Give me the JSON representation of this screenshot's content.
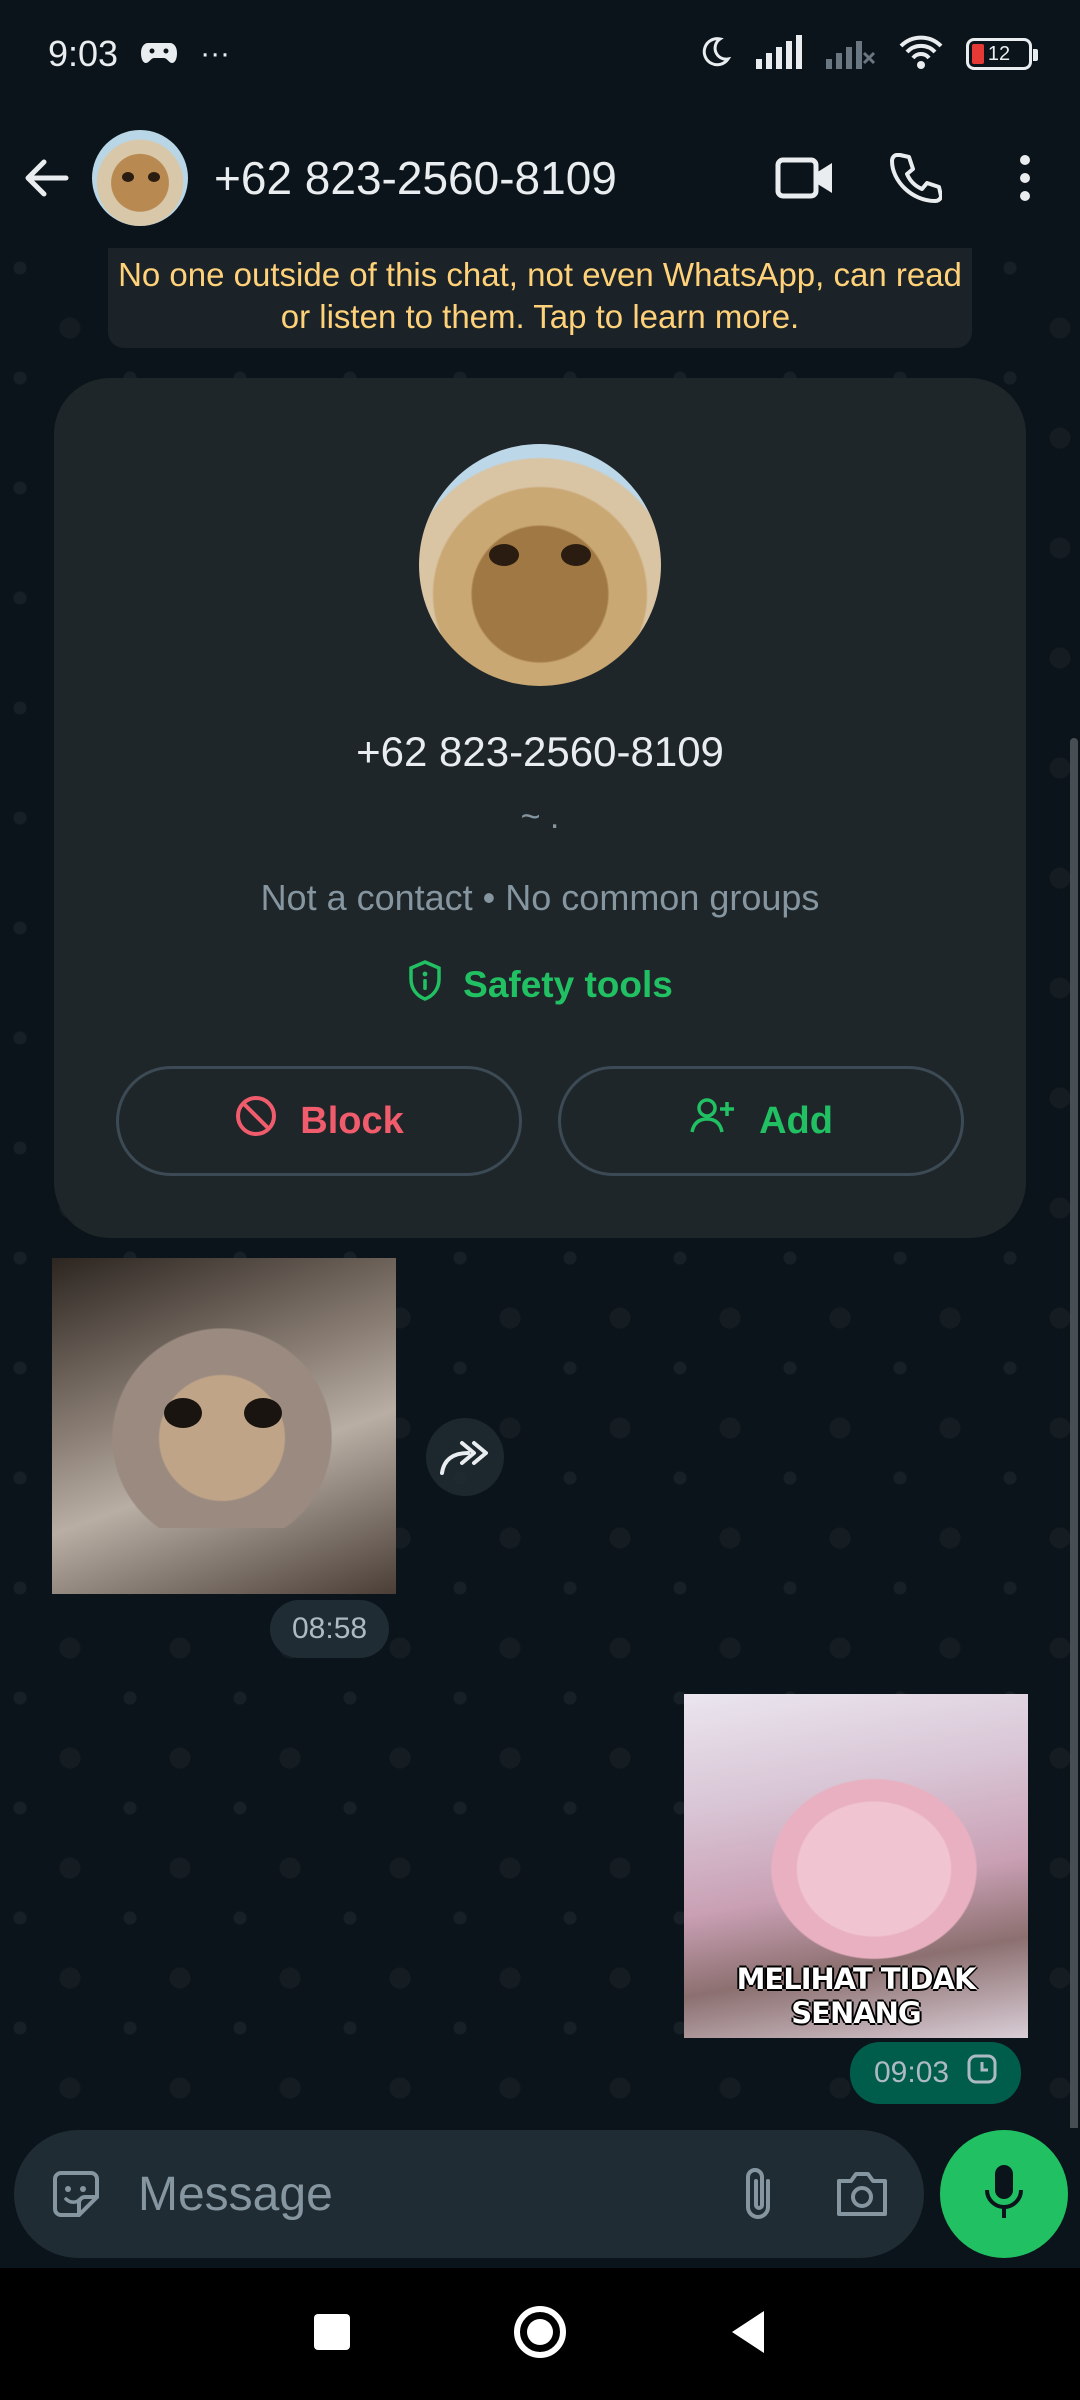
{
  "status_bar": {
    "time": "9:03",
    "more": "···",
    "battery": "12"
  },
  "header": {
    "contact_name": "+62 823-2560-8109"
  },
  "encryption_notice": "No one outside of this chat, not even WhatsApp, can read or listen to them. Tap to learn more.",
  "profile_card": {
    "phone": "+62 823-2560-8109",
    "about": "~ .",
    "meta": "Not a contact • No common groups",
    "safety_label": "Safety tools",
    "block_label": "Block",
    "add_label": "Add"
  },
  "messages": {
    "incoming_time": "08:58",
    "outgoing_caption": "MELIHAT TIDAK SENANG",
    "outgoing_time": "09:03"
  },
  "composer": {
    "placeholder": "Message"
  },
  "icons": {
    "back": "arrow-left-icon",
    "video": "video-camera-icon",
    "call": "phone-icon",
    "menu": "more-vertical-icon",
    "sticker": "sticker-icon",
    "attach": "paperclip-icon",
    "camera": "camera-icon",
    "mic": "microphone-icon",
    "forward": "forward-icon",
    "pending": "clock-icon"
  },
  "colors": {
    "accent": "#21c063",
    "danger": "#f15c6d",
    "notice": "#ffd279",
    "background": "#0b141a"
  }
}
